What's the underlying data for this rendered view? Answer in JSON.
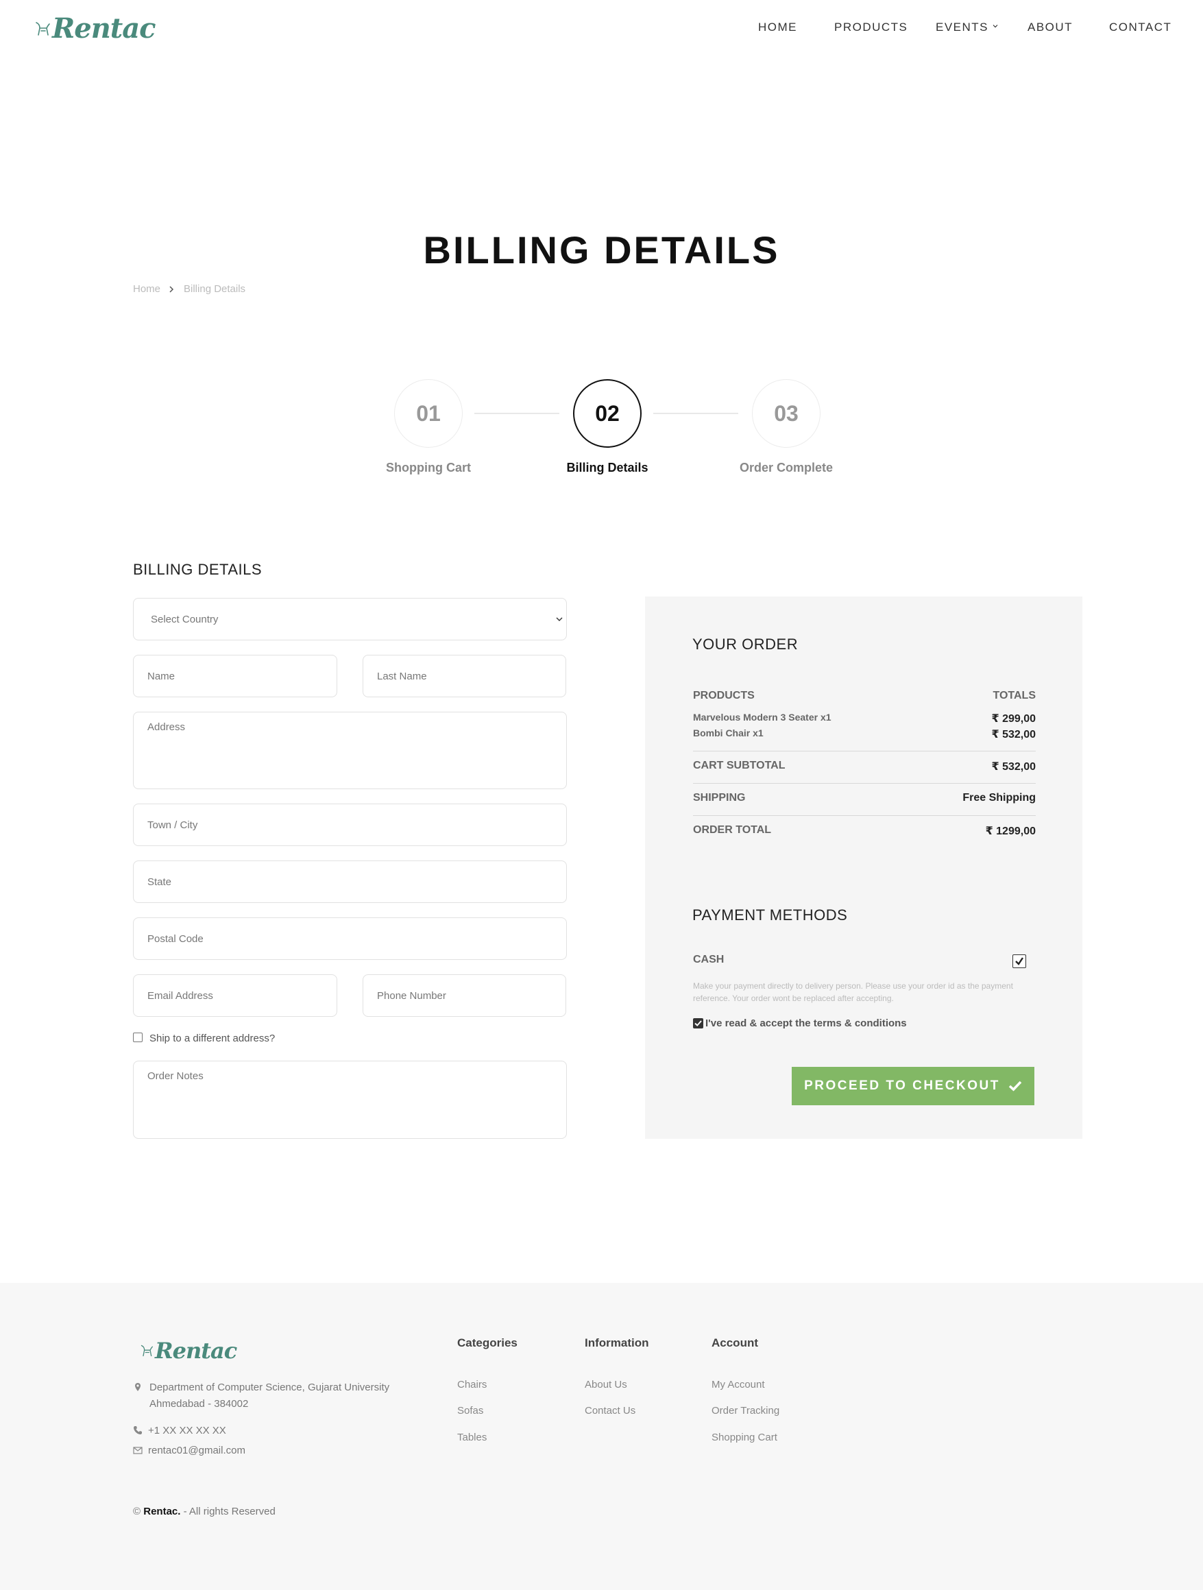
{
  "brand": {
    "name": "Rentac",
    "color": "#4a8a7c"
  },
  "nav": {
    "home": "HOME",
    "products": "PRODUCTS",
    "events": "EVENTS",
    "about": "ABOUT",
    "contact": "CONTACT"
  },
  "page": {
    "title": "BILLING DETAILS"
  },
  "breadcrumb": {
    "home": "Home",
    "current": "Billing Details"
  },
  "steps": [
    {
      "number": "01",
      "label": "Shopping Cart"
    },
    {
      "number": "02",
      "label": "Billing Details"
    },
    {
      "number": "03",
      "label": "Order Complete"
    }
  ],
  "form": {
    "title": "BILLING DETAILS",
    "country_placeholder": "Select Country",
    "name_placeholder": "Name",
    "last_name_placeholder": "Last Name",
    "address_placeholder": "Address",
    "city_placeholder": "Town / City",
    "state_placeholder": "State",
    "postal_placeholder": "Postal Code",
    "email_placeholder": "Email Address",
    "phone_placeholder": "Phone Number",
    "ship_different_label": "Ship to a different address?",
    "notes_placeholder": "Order Notes"
  },
  "order": {
    "title": "YOUR ORDER",
    "products_header": "PRODUCTS",
    "totals_header": "TOTALS",
    "items": [
      {
        "name": "Marvelous Modern 3 Seater x1",
        "price": "₹ 299,00"
      },
      {
        "name": "Bombi Chair x1",
        "price": "₹ 532,00"
      }
    ],
    "subtotal_label": "CART SUBTOTAL",
    "subtotal_value": "₹ 532,00",
    "shipping_label": "SHIPPING",
    "shipping_value": "Free Shipping",
    "total_label": "ORDER TOTAL",
    "total_value": "₹ 1299,00"
  },
  "payment": {
    "title": "PAYMENT METHODS",
    "method_label": "CASH",
    "method_checked": true,
    "description": "Make your payment directly to delivery person. Please use your order id as the payment reference. Your order wont be replaced after accepting.",
    "terms_label": "I've read & accept the terms & conditions",
    "terms_checked": true,
    "checkout_label": "PROCEED TO CHECKOUT",
    "button_color": "#82b865"
  },
  "footer": {
    "address_line1": "Department of Computer Science, Gujarat University",
    "address_line2": "Ahmedabad - 384002",
    "phone": "+1 XX XX XX XX",
    "email": "rentac01@gmail.com",
    "categories": {
      "title": "Categories",
      "links": [
        "Chairs",
        "Sofas",
        "Tables"
      ]
    },
    "information": {
      "title": "Information",
      "links": [
        "About Us",
        "Contact Us"
      ]
    },
    "account": {
      "title": "Account",
      "links": [
        "My Account",
        "Order Tracking",
        "Shopping Cart"
      ]
    },
    "copyright_prefix": "©",
    "copyright_brand": "Rentac.",
    "copyright_suffix": "- All rights Reserved"
  }
}
